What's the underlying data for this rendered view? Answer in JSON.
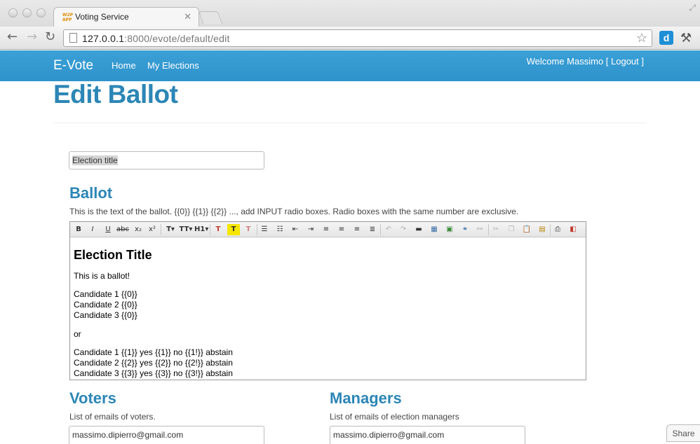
{
  "browser": {
    "tab_title": "Voting Service",
    "favicon_text": "W2P APP",
    "url_host": "127.0.0.1",
    "url_rest": ":8000/evote/default/edit"
  },
  "navbar": {
    "brand": "E-Vote",
    "links": [
      "Home",
      "My Elections"
    ],
    "welcome": "Welcome Massimo [ Logout ]"
  },
  "page": {
    "title": "Edit Ballot"
  },
  "form": {
    "election_title_value": "Election title",
    "ballot_heading": "Ballot",
    "ballot_help": "This is the text of the ballot. {{0}} {{1}} {{2}} ..., add INPUT radio boxes. Radio boxes with the same number are exclusive.",
    "editor": {
      "heading": "Election Title",
      "intro": "This is a ballot!",
      "group1": [
        "Candidate 1 {{0}}",
        "Candidate 2 {{0}}",
        "Candidate 3 {{0}}"
      ],
      "separator": "or",
      "group2": [
        "Candidate 1 {{1}} yes {{1}} no {{1!}} abstain",
        "Candidate 2 {{2}} yes {{2}} no {{2!}} abstain",
        "Candidate 3 {{3}} yes {{3}} no {{3!}} abstain"
      ]
    },
    "voters_heading": "Voters",
    "voters_help": "List of emails of voters.",
    "voters_value": "massimo.dipierro@gmail.com",
    "managers_heading": "Managers",
    "managers_help": "List of emails of election managers",
    "managers_value": "massimo.dipierro@gmail.com"
  },
  "share_label": "Share",
  "colors": {
    "navbar": "#3399d3",
    "heading": "#2c86b6"
  }
}
